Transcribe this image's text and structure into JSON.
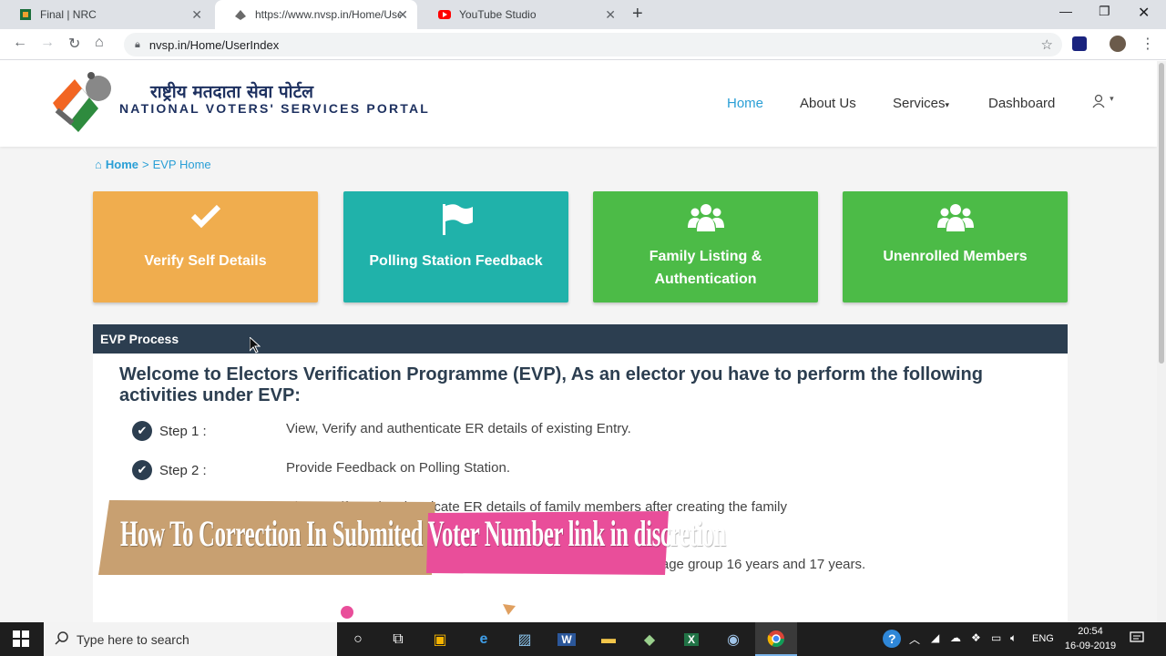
{
  "browser": {
    "tabs": [
      {
        "title": "Final | NRC",
        "active": false
      },
      {
        "title": "https://www.nvsp.in/Home/UserI",
        "active": true
      },
      {
        "title": "YouTube Studio",
        "active": false
      }
    ],
    "url": "nvsp.in/Home/UserIndex"
  },
  "site": {
    "logo_hindi": "राष्ट्रीय मतदाता सेवा पोर्टल",
    "logo_english": "NATIONAL VOTERS' SERVICES PORTAL",
    "nav": [
      {
        "label": "Home",
        "active": true
      },
      {
        "label": "About Us"
      },
      {
        "label": "Services"
      },
      {
        "label": "Dashboard"
      }
    ],
    "accent": "#2a9fd6"
  },
  "breadcrumb": {
    "home": "Home",
    "sep": ">",
    "current": "EVP Home"
  },
  "tiles": [
    {
      "label": "Verify Self Details",
      "icon": "check-icon",
      "color": "#f0ad4e"
    },
    {
      "label": "Polling Station Feedback",
      "icon": "flag-icon",
      "color": "#20b2aa"
    },
    {
      "label": "Family Listing & Authentication",
      "icon": "users-icon",
      "color": "#4cbb47"
    },
    {
      "label": "Unenrolled Members",
      "icon": "users-icon",
      "color": "#4cbb47"
    }
  ],
  "evp": {
    "panel_title": "EVP Process",
    "welcome": "Welcome to Electors Verification Programme (EVP), As an elector you have to perform the following activities under EVP:",
    "steps": [
      {
        "label": "Step 1 :",
        "desc": "View, Verify and authenticate ER details of existing Entry."
      },
      {
        "label": "Step 2 :",
        "desc": "Provide Feedback on Polling Station."
      },
      {
        "label": "",
        "desc": "View, verify and authenticate ER details of family members after creating the family"
      },
      {
        "label": "",
        "desc": "ge as on 1/1/2019) and submit details of family members with age group 16 years and 17 years."
      }
    ]
  },
  "overlay_banner": {
    "text": "How To Correction In Submited Voter Number link in discretion",
    "colors": [
      "#c8a071",
      "#e94e9a"
    ]
  },
  "taskbar": {
    "search_placeholder": "Type here to search",
    "lang": "ENG",
    "time": "20:54",
    "date": "16-09-2019"
  }
}
